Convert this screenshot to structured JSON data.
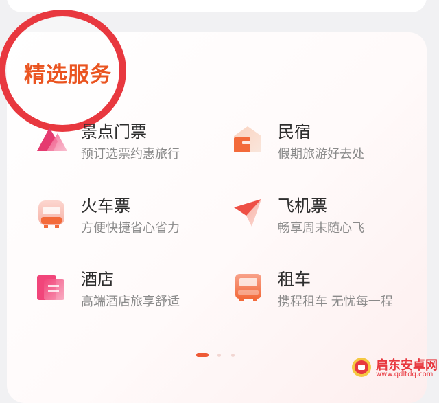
{
  "section": {
    "title": "精选服务"
  },
  "services": [
    {
      "name": "景点门票",
      "desc": "预订选票约惠旅行",
      "icon": "ticket-icon"
    },
    {
      "name": "民宿",
      "desc": "假期旅游好去处",
      "icon": "homestay-icon"
    },
    {
      "name": "火车票",
      "desc": "方便快捷省心省力",
      "icon": "train-icon"
    },
    {
      "name": "飞机票",
      "desc": "畅享周末随心飞",
      "icon": "plane-icon"
    },
    {
      "name": "酒店",
      "desc": "高端酒店旅享舒适",
      "icon": "hotel-icon"
    },
    {
      "name": "租车",
      "desc": "携程租车 无忧每一程",
      "icon": "car-rental-icon"
    }
  ],
  "pagination": {
    "total": 3,
    "active": 1
  },
  "watermark": {
    "title": "启东安卓网",
    "url": "www.qdltdq.com"
  },
  "colors": {
    "accent": "#ea5420",
    "highlight_circle": "#e8383f",
    "icon_pink": "#f1457a",
    "icon_orange": "#f36a3a"
  }
}
